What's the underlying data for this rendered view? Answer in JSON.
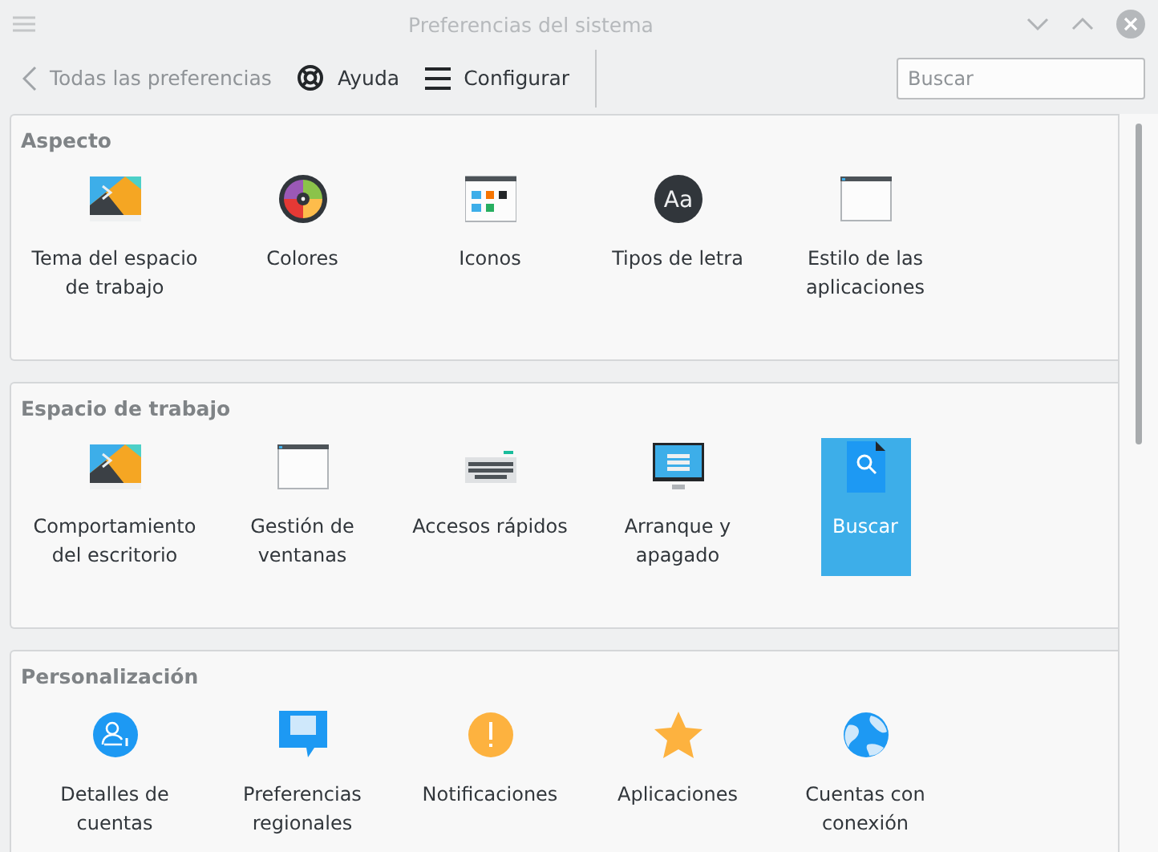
{
  "window": {
    "title": "Preferencias del sistema"
  },
  "toolbar": {
    "back": "Todas las preferencias",
    "help": "Ayuda",
    "configure": "Configurar",
    "search": {
      "placeholder": "Buscar"
    }
  },
  "sections": [
    {
      "title": "Aspecto",
      "items": [
        {
          "label": "Tema del espacio de trabajo",
          "kind": "theme",
          "selected": false
        },
        {
          "label": "Colores",
          "kind": "colors",
          "selected": false
        },
        {
          "label": "Iconos",
          "kind": "icons",
          "selected": false
        },
        {
          "label": "Tipos de letra",
          "kind": "fonts",
          "glyph": "Aa",
          "selected": false
        },
        {
          "label": "Estilo de las aplicaciones",
          "kind": "window",
          "selected": false
        }
      ]
    },
    {
      "title": "Espacio de trabajo",
      "items": [
        {
          "label": "Comportamiento del escritorio",
          "kind": "theme",
          "selected": false
        },
        {
          "label": "Gestión de ventanas",
          "kind": "window",
          "selected": false
        },
        {
          "label": "Accesos rápidos",
          "kind": "keyboard",
          "selected": false
        },
        {
          "label": "Arranque y apagado",
          "kind": "monitor",
          "selected": false
        },
        {
          "label": "Buscar",
          "kind": "search",
          "selected": true
        }
      ]
    },
    {
      "title": "Personalización",
      "items": [
        {
          "label": "Detalles de cuentas",
          "kind": "user",
          "selected": false
        },
        {
          "label": "Preferencias regionales",
          "kind": "chat",
          "selected": false
        },
        {
          "label": "Notificaciones",
          "kind": "warning",
          "selected": false
        },
        {
          "label": "Aplicaciones",
          "kind": "star",
          "selected": false
        },
        {
          "label": "Cuentas con conexión",
          "kind": "globe",
          "selected": false
        }
      ]
    }
  ]
}
